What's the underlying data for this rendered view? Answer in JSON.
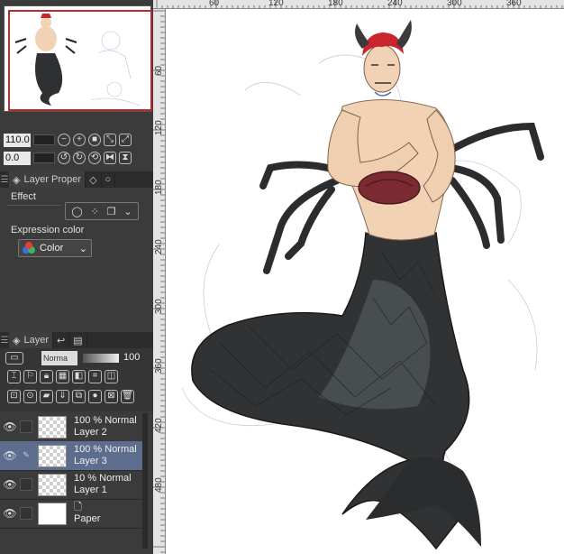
{
  "navigator": {
    "zoom_value": "110.0",
    "rotation_value": "0.0"
  },
  "properties_panel": {
    "tab_label": "Layer Proper",
    "effect_label": "Effect",
    "expression_color_label": "Expression color",
    "expression_color_value": "Color"
  },
  "layer_panel": {
    "tab_label": "Layer",
    "blend_mode": "Norma",
    "opacity": "100",
    "layers": [
      {
        "mode_line": "100 % Normal",
        "name": "Layer 2",
        "selected": false,
        "has_pen": false
      },
      {
        "mode_line": "100 % Normal",
        "name": "Layer 3",
        "selected": true,
        "has_pen": true
      },
      {
        "mode_line": "10 % Normal",
        "name": "Layer 1",
        "selected": false,
        "has_pen": false
      },
      {
        "mode_line": "",
        "name": "Paper",
        "selected": false,
        "has_pen": false
      }
    ]
  },
  "ruler": {
    "top_ticks": [
      "60",
      "120",
      "180",
      "240",
      "300",
      "360"
    ],
    "left_ticks": [
      "60",
      "120",
      "180",
      "240",
      "300",
      "360",
      "420",
      "480"
    ]
  },
  "colors": {
    "panel_bg": "#3b3b3b",
    "selected_layer": "#5d6d8e",
    "nav_frame": "#c0282d",
    "hair": "#c8262b",
    "skin": "#f2d2b4",
    "tail_dark": "#2e3032",
    "tail_mid": "#4c5052",
    "crab_red": "#8a3036"
  },
  "icons": {
    "eye": "eye-icon",
    "pen": "pen-icon",
    "layer_stack": "layer-stack-icon",
    "color_rgb": "rgb-circles-icon"
  }
}
